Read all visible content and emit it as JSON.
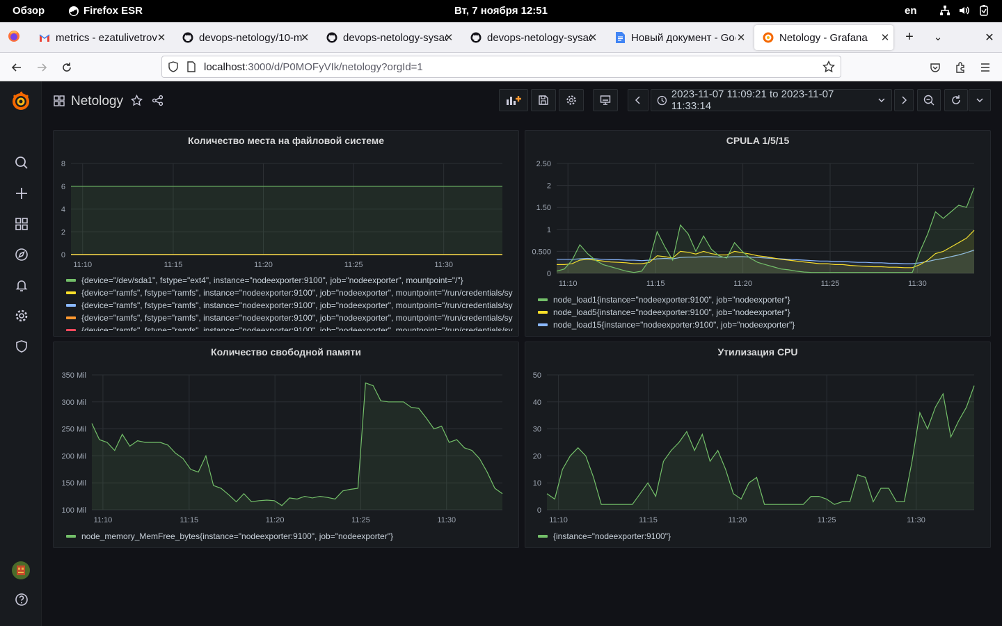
{
  "system": {
    "overview": "Обзор",
    "app_name": "Firefox ESR",
    "clock": "Вт, 7 ноября  12:51",
    "lang": "en"
  },
  "browser": {
    "tabs": [
      {
        "label": "metrics - ezatulivetrov",
        "icon": "gmail-icon"
      },
      {
        "label": "devops-netology/10-m",
        "icon": "github-icon"
      },
      {
        "label": "devops-netology-sysac",
        "icon": "github-icon"
      },
      {
        "label": "devops-netology-sysac",
        "icon": "github-icon"
      },
      {
        "label": "Новый документ - Goo",
        "icon": "docs-icon"
      },
      {
        "label": "Netology - Grafana",
        "icon": "grafana-icon",
        "active": true
      }
    ],
    "url_host": "localhost",
    "url_rest": ":3000/d/P0MOFyVIk/netology?orgId=1"
  },
  "dashboard": {
    "title": "Netology",
    "time_range": "2023-11-07 11:09:21 to 2023-11-07 11:33:14"
  },
  "colors": {
    "green": "#73bf69",
    "yellow": "#fade2a",
    "blue": "#5794f2",
    "cyan": "#8ab8ff",
    "orange": "#ff9830",
    "red": "#f2495c"
  },
  "chart_data": [
    {
      "type": "line",
      "title": "Количество места на файловой системе",
      "x_ticks": [
        "11:10",
        "11:15",
        "11:20",
        "11:25",
        "11:30"
      ],
      "y_ticks": [
        "0",
        "2",
        "4",
        "6",
        "8"
      ],
      "ylim": [
        0,
        8
      ],
      "series": [
        {
          "name": "{device=\"/dev/sda1\", fstype=\"ext4\", instance=\"nodeexporter:9100\", job=\"nodeexporter\", mountpoint=\"/\"}",
          "color": "#73bf69",
          "values": [
            6,
            6,
            6,
            6,
            6,
            6
          ]
        },
        {
          "name": "{device=\"ramfs\", fstype=\"ramfs\", instance=\"nodeexporter:9100\", job=\"nodeexporter\", mountpoint=\"/run/credentials/sy",
          "color": "#fade2a",
          "values": [
            0,
            0,
            0,
            0,
            0,
            0
          ]
        },
        {
          "name": "{device=\"ramfs\", fstype=\"ramfs\", instance=\"nodeexporter:9100\", job=\"nodeexporter\", mountpoint=\"/run/credentials/sy",
          "color": "#8ab8ff",
          "values": [
            0,
            0,
            0,
            0,
            0,
            0
          ]
        },
        {
          "name": "{device=\"ramfs\", fstype=\"ramfs\", instance=\"nodeexporter:9100\", job=\"nodeexporter\", mountpoint=\"/run/credentials/sy",
          "color": "#ff9830",
          "values": [
            0,
            0,
            0,
            0,
            0,
            0
          ]
        },
        {
          "name": "{device=\"ramfs\", fstype=\"ramfs\", instance=\"nodeexporter:9100\", job=\"nodeexporter\", mountpoint=\"/run/credentials/sy",
          "color": "#f2495c",
          "values": [
            0,
            0,
            0,
            0,
            0,
            0
          ]
        }
      ]
    },
    {
      "type": "line",
      "title": "CPULA 1/5/15",
      "x_ticks": [
        "11:10",
        "11:15",
        "11:20",
        "11:25",
        "11:30"
      ],
      "y_ticks": [
        "0",
        "0.500",
        "1",
        "1.50",
        "2",
        "2.50"
      ],
      "ylim": [
        0,
        2.5
      ],
      "series": [
        {
          "name": "node_load1{instance=\"nodeexporter:9100\", job=\"nodeexporter\"}",
          "color": "#73bf69",
          "values": [
            0.05,
            0.1,
            0.3,
            0.65,
            0.45,
            0.3,
            0.2,
            0.15,
            0.1,
            0.05,
            0.02,
            0.05,
            0.3,
            0.95,
            0.6,
            0.3,
            1.1,
            0.9,
            0.5,
            0.85,
            0.55,
            0.4,
            0.35,
            0.7,
            0.5,
            0.35,
            0.25,
            0.2,
            0.15,
            0.1,
            0.08,
            0.05,
            0.03,
            0.02,
            0.02,
            0.02,
            0.02,
            0.02,
            0.02,
            0.02,
            0.02,
            0.02,
            0.02,
            0.02,
            0.02,
            0.02,
            0.02,
            0.5,
            0.9,
            1.4,
            1.25,
            1.4,
            1.55,
            1.5,
            1.95
          ]
        },
        {
          "name": "node_load5{instance=\"nodeexporter:9100\", job=\"nodeexporter\"}",
          "color": "#fade2a",
          "values": [
            0.2,
            0.2,
            0.22,
            0.3,
            0.32,
            0.3,
            0.28,
            0.26,
            0.25,
            0.24,
            0.22,
            0.22,
            0.25,
            0.4,
            0.38,
            0.35,
            0.5,
            0.48,
            0.44,
            0.5,
            0.45,
            0.42,
            0.42,
            0.5,
            0.47,
            0.44,
            0.4,
            0.38,
            0.35,
            0.32,
            0.3,
            0.28,
            0.26,
            0.24,
            0.22,
            0.22,
            0.2,
            0.2,
            0.18,
            0.17,
            0.16,
            0.15,
            0.15,
            0.14,
            0.14,
            0.13,
            0.13,
            0.2,
            0.3,
            0.45,
            0.5,
            0.6,
            0.7,
            0.8,
            0.98
          ]
        },
        {
          "name": "node_load15{instance=\"nodeexporter:9100\", job=\"nodeexporter\"}",
          "color": "#8ab8ff",
          "values": [
            0.32,
            0.32,
            0.32,
            0.33,
            0.34,
            0.33,
            0.32,
            0.31,
            0.31,
            0.3,
            0.3,
            0.29,
            0.3,
            0.33,
            0.34,
            0.33,
            0.36,
            0.37,
            0.37,
            0.38,
            0.38,
            0.37,
            0.37,
            0.38,
            0.38,
            0.37,
            0.36,
            0.35,
            0.34,
            0.33,
            0.32,
            0.31,
            0.3,
            0.29,
            0.28,
            0.28,
            0.27,
            0.27,
            0.26,
            0.25,
            0.25,
            0.24,
            0.24,
            0.23,
            0.23,
            0.22,
            0.22,
            0.24,
            0.27,
            0.31,
            0.34,
            0.38,
            0.42,
            0.47,
            0.53
          ]
        }
      ]
    },
    {
      "type": "area",
      "title": "Количество свободной памяти",
      "x_ticks": [
        "11:10",
        "11:15",
        "11:20",
        "11:25",
        "11:30"
      ],
      "y_ticks": [
        "100 Mil",
        "150 Mil",
        "200 Mil",
        "250 Mil",
        "300 Mil",
        "350 Mil"
      ],
      "ylim": [
        100,
        350
      ],
      "series": [
        {
          "name": "node_memory_MemFree_bytes{instance=\"nodeexporter:9100\", job=\"nodeexporter\"}",
          "color": "#73bf69",
          "values": [
            260,
            230,
            225,
            210,
            240,
            218,
            228,
            225,
            225,
            225,
            220,
            205,
            195,
            175,
            170,
            200,
            145,
            140,
            128,
            115,
            130,
            115,
            117,
            118,
            117,
            108,
            122,
            120,
            125,
            122,
            125,
            123,
            120,
            135,
            138,
            140,
            335,
            330,
            302,
            300,
            300,
            300,
            290,
            288,
            270,
            250,
            255,
            225,
            230,
            215,
            210,
            195,
            170,
            140,
            130
          ]
        }
      ]
    },
    {
      "type": "area",
      "title": "Утилизация CPU",
      "x_ticks": [
        "11:10",
        "11:15",
        "11:20",
        "11:25",
        "11:30"
      ],
      "y_ticks": [
        "0",
        "10",
        "20",
        "30",
        "40",
        "50"
      ],
      "ylim": [
        0,
        50
      ],
      "series": [
        {
          "name": "{instance=\"nodeexporter:9100\"}",
          "color": "#73bf69",
          "values": [
            6,
            4,
            15,
            20,
            23,
            20,
            12,
            2,
            2,
            2,
            2,
            2,
            6,
            10,
            5,
            18,
            22,
            25,
            29,
            22,
            28,
            18,
            22,
            15,
            6,
            4,
            10,
            12,
            2,
            2,
            2,
            2,
            2,
            2,
            5,
            5,
            4,
            2,
            3,
            3,
            13,
            12,
            3,
            8,
            8,
            3,
            3,
            18,
            36,
            30,
            38,
            43,
            27,
            33,
            38,
            46
          ]
        }
      ]
    }
  ]
}
